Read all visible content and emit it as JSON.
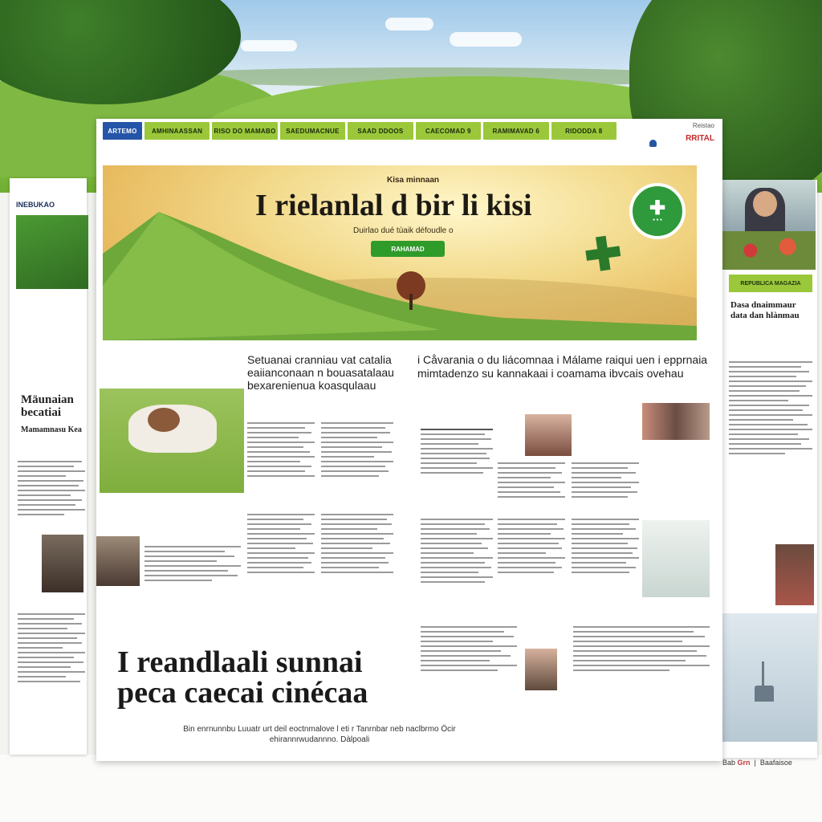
{
  "nav": {
    "tabs": [
      "ARTEMO",
      "AMHINAASSAN",
      "RISO DO MAMABO",
      "SAEDUMACNUE",
      "SAAD DDOOS",
      "CAECOMAD 9",
      "RAMIMAVAD 6",
      "RIDODDA 8"
    ]
  },
  "brand": {
    "small": "Reistao",
    "large": "RRITAL"
  },
  "hero": {
    "kicker": "Kisa minnaan",
    "title": "I rielanlal d bir li kisi",
    "subtitle": "Duirlao dué tùaik défoudle o",
    "cta": "RAHAMAD"
  },
  "left": {
    "label": "INEBUKAO",
    "heading1": "Mäunaian",
    "heading2": "becatiai",
    "heading3": "Mamamnasu Kea"
  },
  "col1": {
    "heading": "Setuanai cranniau vat catalia eaiianconaan n bouasatalaau bexarenienua koasqulaau"
  },
  "col2": {
    "heading": "i Cåvarania o du liácomnaa i Málame raiqui uen i epprnaia mimtadenzo su kannakaai i coamama ibvcais ovehau"
  },
  "feature": {
    "title_line1": "I reandlaali sunnai",
    "title_line2": "peca caecai cinécaa",
    "caption": "Bin enrnunnbu Luuatr urt deil eoctnmalove l eti r Tanrnbar neb naclbrmo Öcir ehirannrwudannno. Dàlpoali"
  },
  "right": {
    "tag": "REPUBLICA MAGAZIA",
    "headline": "Dasa dnaimmaur data dan hlànmau"
  },
  "footer": {
    "left": "Bab",
    "red": "Grn",
    "right": "Baafaisoe"
  }
}
